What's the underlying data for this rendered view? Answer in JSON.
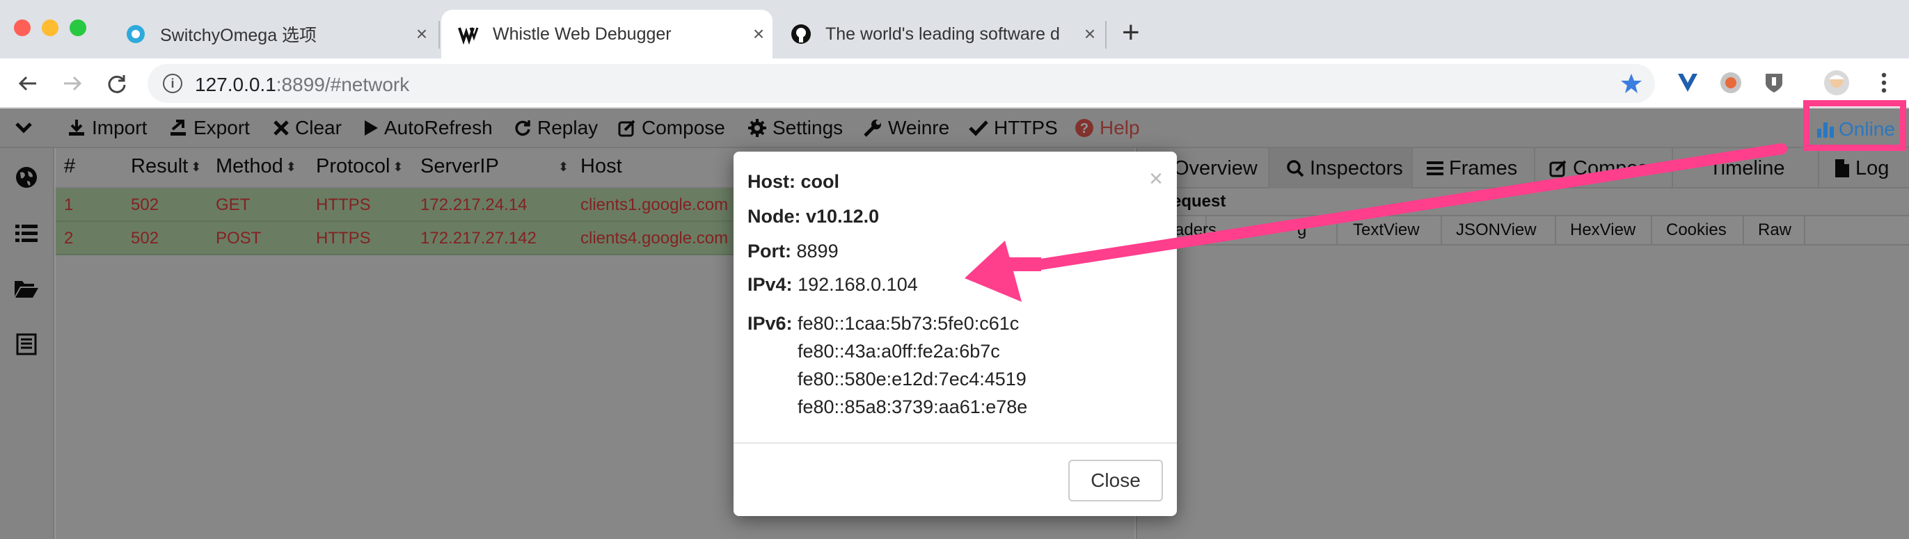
{
  "browser": {
    "tabs": [
      {
        "title": "SwitchyOmega 选项",
        "close": "×",
        "icon": "switchyomega-icon"
      },
      {
        "title": "Whistle Web Debugger",
        "close": "×",
        "icon": "whistle-icon"
      },
      {
        "title": "The world's leading software d",
        "close": "×",
        "icon": "github-icon"
      }
    ],
    "new_tab": "+",
    "url_host": "127.0.0.1",
    "url_rest": ":8899/#network",
    "info_glyph": "i"
  },
  "menu": {
    "items": [
      {
        "label": "Import",
        "icon": "import-icon"
      },
      {
        "label": "Export",
        "icon": "export-icon"
      },
      {
        "label": "Clear",
        "icon": "clear-icon"
      },
      {
        "label": "AutoRefresh",
        "icon": "play-icon"
      },
      {
        "label": "Replay",
        "icon": "refresh-icon"
      },
      {
        "label": "Compose",
        "icon": "edit-icon"
      },
      {
        "label": "Settings",
        "icon": "gear-icon"
      },
      {
        "label": "Weinre",
        "icon": "wrench-icon"
      },
      {
        "label": "HTTPS",
        "icon": "checkmark-icon"
      },
      {
        "label": "Help",
        "icon": "question-icon"
      }
    ],
    "online": "Online",
    "help_color": "#e0574f"
  },
  "network": {
    "columns": [
      "#",
      "Result",
      "Method",
      "Protocol",
      "ServerIP",
      "Host"
    ],
    "rows": [
      {
        "num": "1",
        "result": "502",
        "method": "GET",
        "protocol": "HTTPS",
        "ip": "172.217.24.14",
        "host": "clients1.google.com"
      },
      {
        "num": "2",
        "result": "502",
        "method": "POST",
        "protocol": "HTTPS",
        "ip": "172.217.27.142",
        "host": "clients4.google.com"
      }
    ]
  },
  "detail": {
    "tabs": [
      "Overview",
      "Inspectors",
      "Frames",
      "Compos",
      "Timeline",
      "Log"
    ],
    "request_label": "equest",
    "sub_tabs": [
      "aders",
      "g",
      "TextView",
      "JSONView",
      "HexView",
      "Cookies",
      "Raw"
    ]
  },
  "modal": {
    "close_x": "×",
    "host_label": "Host:",
    "host_value": "cool",
    "node_label": "Node:",
    "node_value": "v10.12.0",
    "port_label": "Port:",
    "port_value": "8899",
    "ipv4_label": "IPv4:",
    "ipv4_value": "192.168.0.104",
    "ipv6_label": "IPv6:",
    "ipv6_values": [
      "fe80::1caa:5b73:5fe0:c61c",
      "fe80::43a:a0ff:fe2a:6b7c",
      "fe80::580e:e12d:7ec4:4519",
      "fe80::85a8:3739:aa61:e78e"
    ],
    "close_button": "Close"
  },
  "colors": {
    "highlight": "#ff3e8c",
    "row_bg": "#b7d7ab",
    "row_text": "#e23b3b",
    "online_text": "#2b77bf"
  }
}
